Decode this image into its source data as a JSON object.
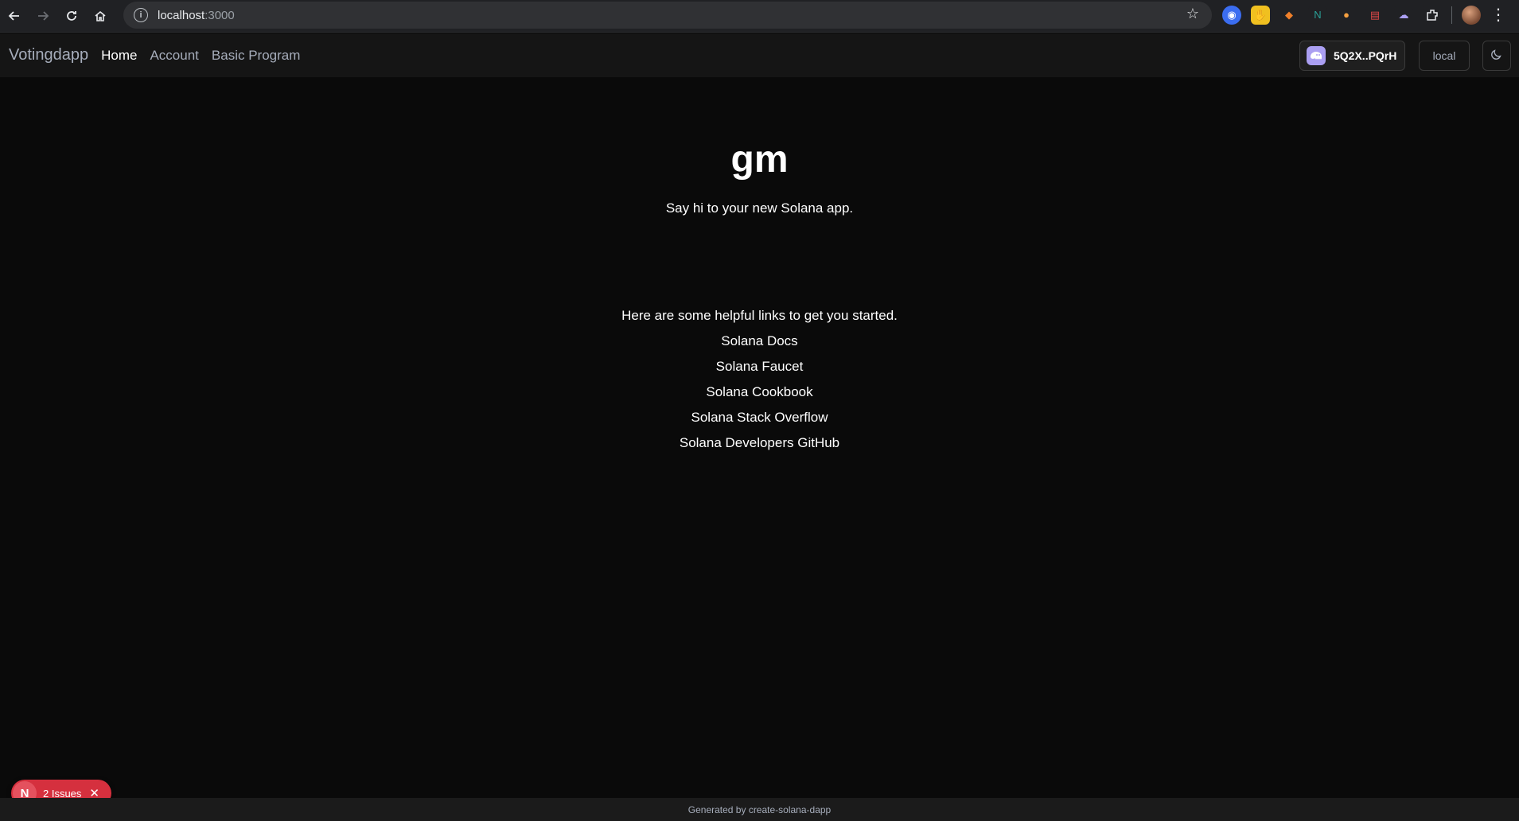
{
  "browser": {
    "url_host": "localhost",
    "url_port": ":3000",
    "icons": [
      "back-icon",
      "forward-icon",
      "reload-icon",
      "home-icon",
      "site-info-icon",
      "star-icon",
      "extensions-icon",
      "menu-icon"
    ]
  },
  "navbar": {
    "brand": "Votingdapp",
    "links": [
      {
        "label": "Home",
        "active": true
      },
      {
        "label": "Account",
        "active": false
      },
      {
        "label": "Basic Program",
        "active": false
      }
    ],
    "wallet_address": "5Q2X..PQrH",
    "cluster": "local"
  },
  "hero": {
    "title": "gm",
    "subtitle": "Say hi to your new Solana app."
  },
  "links": {
    "intro": "Here are some helpful links to get you started.",
    "items": [
      "Solana Docs",
      "Solana Faucet",
      "Solana Cookbook",
      "Solana Stack Overflow",
      "Solana Developers GitHub"
    ]
  },
  "issues_badge": {
    "logo": "N",
    "label": "2 Issues"
  },
  "footer": {
    "text": "Generated by create-solana-dapp"
  },
  "colors": {
    "background": "#0a0a0a",
    "navbar": "#151515",
    "issues_badge": "#d5303e",
    "wallet_icon": "#ab9ff2"
  }
}
